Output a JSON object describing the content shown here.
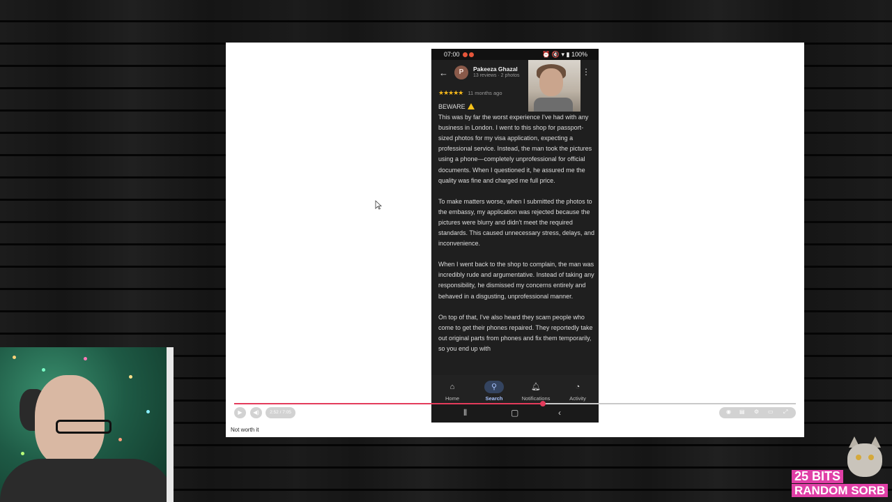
{
  "phone": {
    "status_bar": {
      "time": "07:00",
      "battery": "100%"
    },
    "review": {
      "reviewer_name": "Pakeeza Ghazal",
      "reviewer_meta": "13 reviews · 2 photos",
      "avatar_initial": "P",
      "stars": "★★★★★",
      "age": "11 months ago",
      "beware": "BEWARE",
      "paragraphs": [
        "This was by far the worst experience I've had with any business in London. I went to this shop for passport-sized photos for my visa application, expecting a professional service. Instead, the man took the pictures using a phone—completely unprofessional for official documents. When I questioned it, he assured me the quality was fine and charged me full price.",
        "To make matters worse, when I submitted the photos to the embassy, my application was rejected because the pictures were blurry and didn't meet the required standards. This caused unnecessary stress, delays, and inconvenience.",
        "When I went back to the shop to complain, the man was incredibly rude and argumentative. Instead of taking any responsibility, he dismissed my concerns entirely and behaved in a disgusting, unprofessional manner.",
        "On top of that, I've also heard they scam people who come to get their phones repaired. They reportedly take out original parts from phones and fix them temporarily, so you end up with"
      ]
    },
    "bottom_nav": [
      {
        "label": "Home",
        "icon": "home-icon"
      },
      {
        "label": "Search",
        "icon": "search-icon",
        "active": true
      },
      {
        "label": "Notifications",
        "icon": "bell-icon"
      },
      {
        "label": "Activity",
        "icon": "activity-icon"
      }
    ]
  },
  "player": {
    "time": "2:52 / 7:05",
    "progress": 0.55,
    "title": "Not worth it"
  },
  "branding": {
    "line1": "25 BITS",
    "line2": "RANDOM SORB"
  },
  "colors": {
    "progress": "#e33b5b",
    "stars": "#f6b81a",
    "brand": "#e03fa6",
    "active_nav": "#a9c4ff"
  }
}
